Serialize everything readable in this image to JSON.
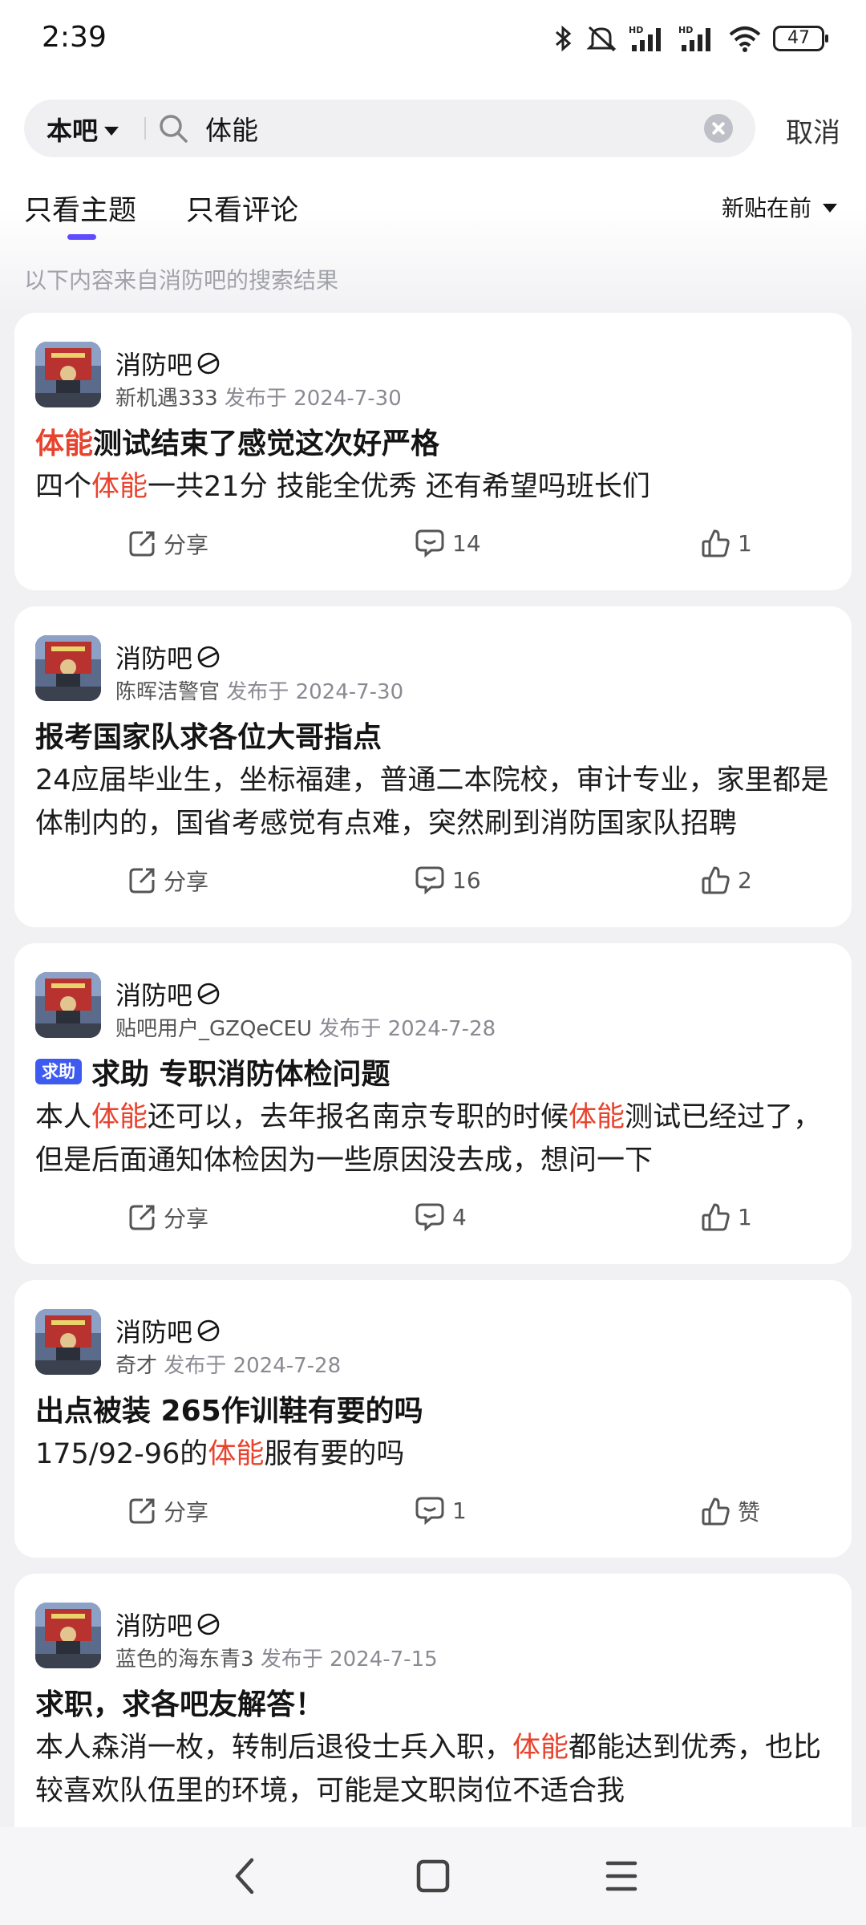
{
  "status_bar": {
    "time": "2:39",
    "battery": "47"
  },
  "search": {
    "scope": "本吧",
    "query": "体能",
    "cancel": "取消"
  },
  "tabs": {
    "topics": "只看主题",
    "comments": "只看评论"
  },
  "sort": "新贴在前",
  "source_note": "以下内容来自消防吧的搜索结果",
  "labels": {
    "share": "分享",
    "published": "发布于"
  },
  "posts": [
    {
      "forum": "消防吧",
      "author": "新机遇333",
      "date": "2024-7-30",
      "title": {
        "a": "体能",
        "b": "测试结束了感觉这次好严格"
      },
      "body": {
        "a": "四个",
        "b": "体能",
        "c": "一共21分 技能全优秀 还有希望吗班长们"
      },
      "comments": "14",
      "likes": "1"
    },
    {
      "forum": "消防吧",
      "author": "陈晖洁警官",
      "date": "2024-7-30",
      "title": "报考国家队求各位大哥指点",
      "body": "24应届毕业生，坐标福建，普通二本院校，审计专业，家里都是体制内的，国省考感觉有点难，突然刷到消防国家队招聘",
      "comments": "16",
      "likes": "2"
    },
    {
      "forum": "消防吧",
      "author": "贴吧用户_GZQeCEU",
      "date": "2024-7-28",
      "badge": "求助",
      "title": "求助 专职消防体检问题",
      "body": {
        "a": "本人",
        "b": "体能",
        "c": "还可以，去年报名南京专职的时候",
        "d": "体能",
        "e": "测试已经过了，但是后面通知体检因为一些原因没去成，想问一下"
      },
      "comments": "4",
      "likes": "1"
    },
    {
      "forum": "消防吧",
      "author": "奇才",
      "date": "2024-7-28",
      "title": "出点被装 265作训鞋有要的吗",
      "body": {
        "a": "175/92-96的",
        "b": "体能",
        "c": "服有要的吗"
      },
      "comments": "1",
      "likes": "赞"
    },
    {
      "forum": "消防吧",
      "author": "蓝色的海东青3",
      "date": "2024-7-15",
      "title": "求职，求各吧友解答！",
      "body": {
        "a": "本人森消一枚，转制后退役士兵入职，",
        "b": "体能",
        "c": "都能达到优秀，也比较喜欢队伍里的环境，可能是文职岗位不适合我"
      }
    }
  ],
  "colors": {
    "highlight": "#e8432e",
    "accent": "#614bff",
    "badge": "#3e5bf1"
  },
  "icons": [
    "bluetooth-icon",
    "mute-icon",
    "signal-icon",
    "wifi-icon",
    "search-icon",
    "clear-icon",
    "share-icon",
    "comment-icon",
    "like-icon",
    "back-icon",
    "home-icon",
    "menu-icon"
  ]
}
